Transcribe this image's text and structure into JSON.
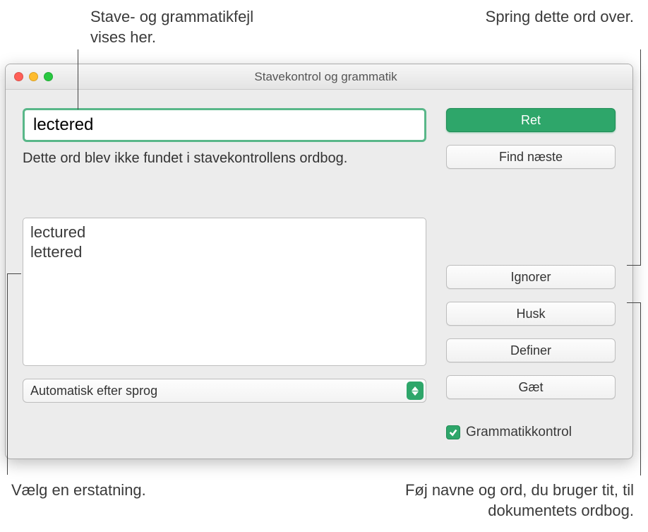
{
  "dialog": {
    "title": "Stavekontrol og grammatik",
    "error_word": "lectered",
    "explanation": "Dette ord blev ikke fundet i stavekontrollens ordbog.",
    "suggestions": [
      "lectured",
      "lettered"
    ],
    "language_select": "Automatisk efter sprog",
    "grammar_check_label": "Grammatikkontrol",
    "buttons": {
      "correct": "Ret",
      "find_next": "Find næste",
      "ignore": "Ignorer",
      "learn": "Husk",
      "define": "Definer",
      "guess": "Gæt"
    }
  },
  "callouts": {
    "top_left": "Stave- og grammatikfejl vises her.",
    "top_right": "Spring dette ord over.",
    "bottom_left": "Vælg en erstatning.",
    "bottom_right": "Føj navne og ord, du bruger tit, til dokumentets ordbog."
  }
}
